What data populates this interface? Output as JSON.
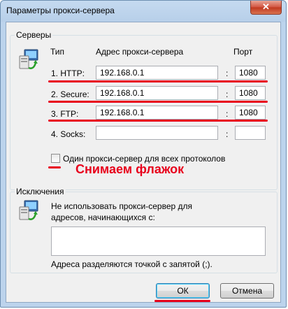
{
  "window": {
    "title": "Параметры прокси-сервера",
    "close_glyph": "✕"
  },
  "servers": {
    "group_title": "Серверы",
    "col_type": "Тип",
    "col_address": "Адрес прокси-сервера",
    "col_port": "Порт",
    "rows": [
      {
        "label": "1. HTTP:",
        "address": "192.168.0.1",
        "port": "1080"
      },
      {
        "label": "2. Secure:",
        "address": "192.168.0.1",
        "port": "1080"
      },
      {
        "label": "3. FTP:",
        "address": "192.168.0.1",
        "port": "1080"
      },
      {
        "label": "4. Socks:",
        "address": "",
        "port": ""
      }
    ],
    "colon": ":",
    "same_proxy_checkbox": {
      "label": "Один прокси-сервер для всех протоколов",
      "checked": false
    }
  },
  "annotation": {
    "text": "Снимаем флажок",
    "color": "#e8001c"
  },
  "exceptions": {
    "group_title": "Исключения",
    "description": "Не использовать прокси-сервер для адресов, начинающихся с:",
    "textarea_value": "",
    "hint": "Адреса разделяются точкой с запятой (;)."
  },
  "buttons": {
    "ok": "ОК",
    "cancel": "Отмена"
  },
  "icons": {
    "servers_icon": "network-computer-icon",
    "exceptions_icon": "network-computer-icon"
  }
}
